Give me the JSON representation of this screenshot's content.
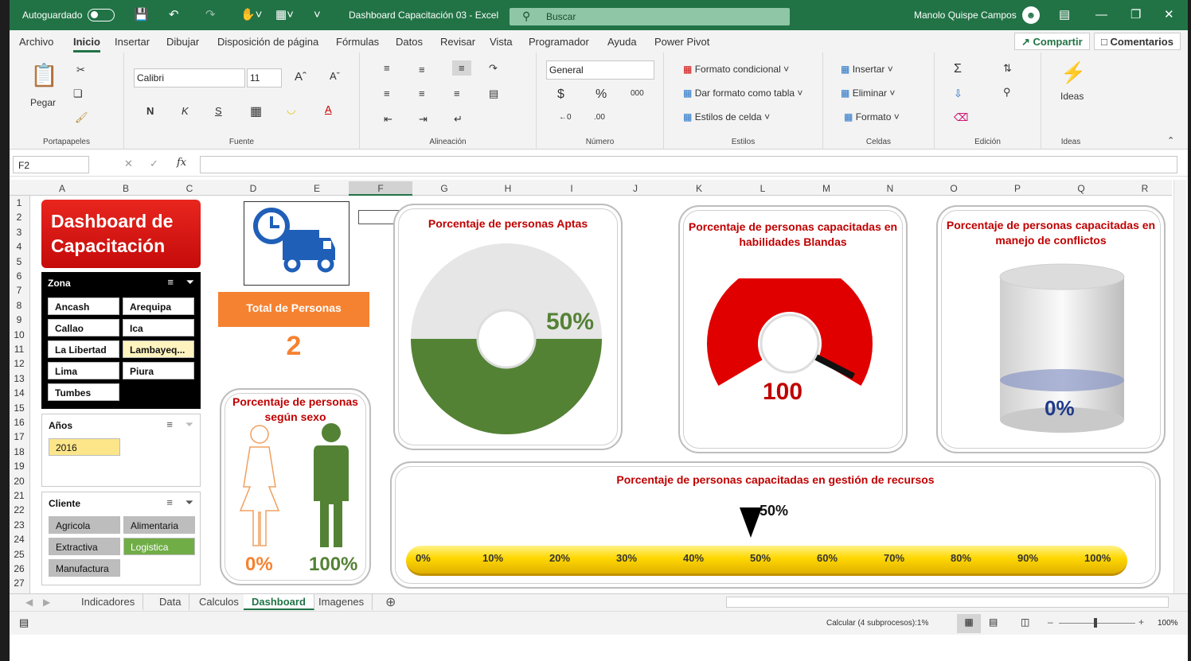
{
  "titlebar": {
    "autosave": "Autoguardado",
    "doc_title": "Dashboard Capacitación 03  -  Excel",
    "search": "Buscar",
    "user": "Manolo Quispe Campos"
  },
  "menu": [
    "Archivo",
    "Inicio",
    "Insertar",
    "Dibujar",
    "Disposición de página",
    "Fórmulas",
    "Datos",
    "Revisar",
    "Vista",
    "Programador",
    "Ayuda",
    "Power Pivot"
  ],
  "menu_active": "Inicio",
  "share": "Compartir",
  "comments": "Comentarios",
  "ribbon": {
    "clipboard": {
      "paste": "Pegar",
      "label": "Portapapeles"
    },
    "font": {
      "name": "Calibri",
      "size": "11",
      "label": "Fuente",
      "bold": "N",
      "italic": "K",
      "underline": "S"
    },
    "alignment": {
      "label": "Alineación"
    },
    "number": {
      "format": "General",
      "label": "Número",
      "thousands": "000"
    },
    "styles": {
      "cond": "Formato condicional",
      "table": "Dar formato como tabla",
      "cell": "Estilos de celda",
      "label": "Estilos"
    },
    "cells": {
      "insert": "Insertar",
      "delete": "Eliminar",
      "format": "Formato",
      "label": "Celdas"
    },
    "editing": {
      "label": "Edición"
    },
    "ideas": {
      "btn": "Ideas",
      "label": "Ideas"
    }
  },
  "formula": {
    "namebox": "F2",
    "fx": "fx"
  },
  "columns": [
    "A",
    "B",
    "C",
    "D",
    "E",
    "F",
    "G",
    "H",
    "I",
    "J",
    "K",
    "L",
    "M",
    "N",
    "O",
    "P",
    "Q",
    "R"
  ],
  "rows": [
    "1",
    "2",
    "3",
    "4",
    "5",
    "6",
    "7",
    "8",
    "9",
    "10",
    "11",
    "12",
    "13",
    "14",
    "15",
    "16",
    "17",
    "18",
    "19",
    "20",
    "21",
    "22",
    "23",
    "24",
    "25",
    "26",
    "27"
  ],
  "dashboard": {
    "title": "Dashboard de Capacitación",
    "zona": {
      "header": "Zona",
      "items": [
        "Ancash",
        "Arequipa",
        "Callao",
        "Ica",
        "La Libertad",
        "Lambayeq...",
        "Lima",
        "Piura",
        "Tumbes"
      ],
      "selected": "Lambayeq..."
    },
    "anios": {
      "header": "Años",
      "items": [
        "2016"
      ]
    },
    "cliente": {
      "header": "Cliente",
      "items": [
        "Agricola",
        "Alimentaria",
        "Extractiva",
        "Logistica",
        "Manufactura"
      ],
      "selected": "Logistica"
    },
    "total_label": "Total de Personas",
    "total_value": "2",
    "sexo": {
      "title": "Porcentaje de personas según sexo",
      "female": "0%",
      "male": "100%"
    },
    "aptas": {
      "title": "Porcentaje de personas Aptas",
      "value": "50%",
      "fraction": 0.5
    },
    "blandas": {
      "title": "Porcentaje de personas capacitadas en habilidades Blandas",
      "value": "100",
      "fraction": 1.0
    },
    "conflictos": {
      "title": "Porcentaje de personas capacitadas en manejo de conflictos",
      "value": "0%",
      "fraction": 0.0
    },
    "recursos": {
      "title": "Porcentaje de personas capacitadas en gestión de recursos",
      "value": "50%",
      "fraction": 0.5,
      "ticks": [
        "0%",
        "10%",
        "20%",
        "30%",
        "40%",
        "50%",
        "60%",
        "70%",
        "80%",
        "90%",
        "100%"
      ]
    }
  },
  "sheets": [
    "Indicadores",
    "Data",
    "Calculos",
    "Dashboard",
    "Imagenes"
  ],
  "active_sheet": "Dashboard",
  "status": {
    "calc": "Calcular (4 subprocesos):1%",
    "zoom": "100%"
  },
  "colors": {
    "excel_green": "#217346",
    "red": "#c00000",
    "orange": "#f58231",
    "green": "#548235",
    "yellow": "#ffd700",
    "blue": "#1f6fc5"
  }
}
